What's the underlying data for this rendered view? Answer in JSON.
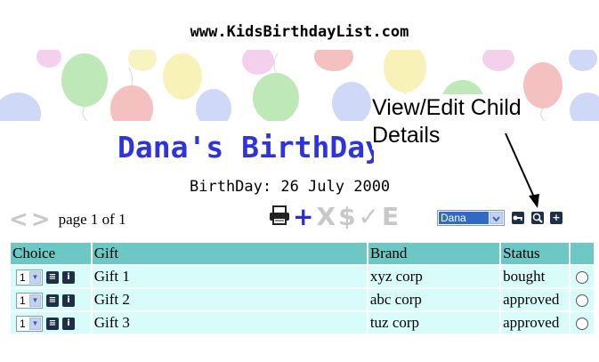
{
  "site": {
    "url": "www.KidsBirthdayList.com"
  },
  "child": {
    "name_title": "Dana's BirthDay",
    "birthday": "BirthDay: 26 July 2000"
  },
  "annotation": {
    "line1": "View/Edit Child",
    "line2": "Details"
  },
  "nav": {
    "prev_icon": "<",
    "next_icon": ">",
    "page_text": "page 1 of 1"
  },
  "toolbar": {
    "print": "print-icon",
    "add": "+",
    "delete": "X",
    "dollar": "$",
    "check": "✓",
    "edit": "E"
  },
  "child_select": {
    "value": "Dana"
  },
  "table": {
    "headers": {
      "choice": "Choice",
      "gift": "Gift",
      "brand": "Brand",
      "status": "Status"
    },
    "rows": [
      {
        "choice": "1",
        "gift": "Gift 1",
        "brand": "xyz corp",
        "status": "bought"
      },
      {
        "choice": "1",
        "gift": "Gift 2",
        "brand": "abc corp",
        "status": "approved"
      },
      {
        "choice": "1",
        "gift": "Gift 3",
        "brand": "tuz corp",
        "status": "approved"
      }
    ]
  }
}
